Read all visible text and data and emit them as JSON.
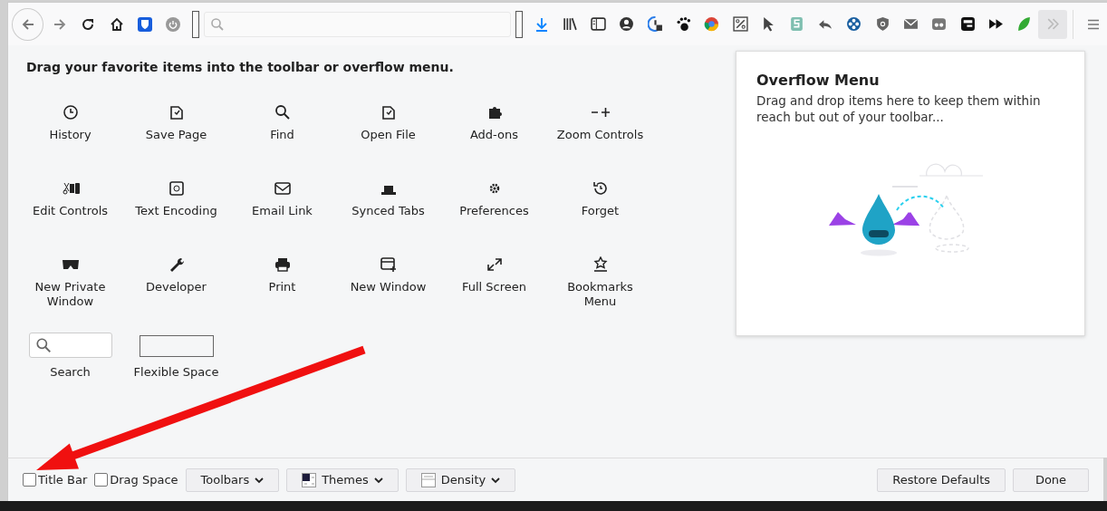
{
  "heading": "Drag your favorite items into the toolbar or overflow menu.",
  "palette": [
    {
      "kind": "icon",
      "label": "History"
    },
    {
      "kind": "icon",
      "label": "Save Page"
    },
    {
      "kind": "icon",
      "label": "Find"
    },
    {
      "kind": "icon",
      "label": "Open File"
    },
    {
      "kind": "icon",
      "label": "Add-ons"
    },
    {
      "kind": "icon",
      "label": "Zoom Controls"
    },
    {
      "kind": "icon",
      "label": "Edit Controls"
    },
    {
      "kind": "icon",
      "label": "Text Encoding"
    },
    {
      "kind": "icon",
      "label": "Email Link"
    },
    {
      "kind": "icon",
      "label": "Synced Tabs"
    },
    {
      "kind": "icon",
      "label": "Preferences"
    },
    {
      "kind": "icon",
      "label": "Forget"
    },
    {
      "kind": "icon",
      "label": "New Private Window"
    },
    {
      "kind": "icon",
      "label": "Developer"
    },
    {
      "kind": "icon",
      "label": "Print"
    },
    {
      "kind": "icon",
      "label": "New Window"
    },
    {
      "kind": "icon",
      "label": "Full Screen"
    },
    {
      "kind": "icon",
      "label": "Bookmarks Menu"
    },
    {
      "kind": "search",
      "label": "Search"
    },
    {
      "kind": "spacer",
      "label": "Flexible Space"
    }
  ],
  "overflow_panel": {
    "title": "Overflow Menu",
    "text": "Drag and drop items here to keep them within reach but out of your toolbar..."
  },
  "footer": {
    "checkboxes": [
      {
        "label": "Title Bar",
        "checked": false
      },
      {
        "label": "Drag Space",
        "checked": false
      }
    ],
    "menus": [
      {
        "label": "Toolbars",
        "kind": "plain"
      },
      {
        "label": "Themes",
        "kind": "themes"
      },
      {
        "label": "Density",
        "kind": "density"
      }
    ],
    "buttons": [
      "Restore Defaults",
      "Done"
    ]
  }
}
